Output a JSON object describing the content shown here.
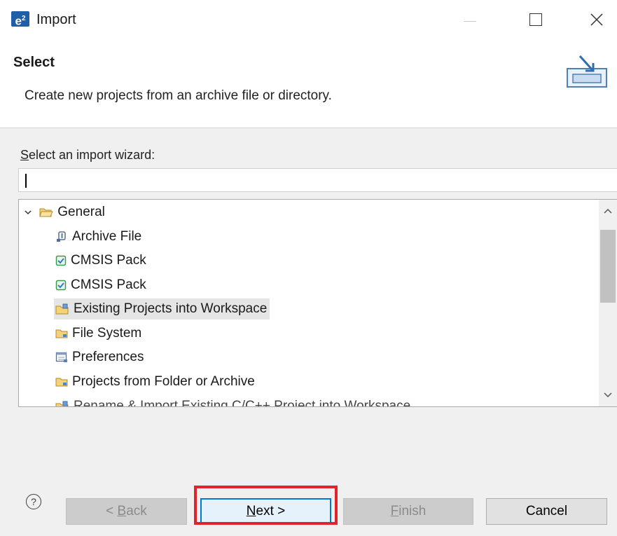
{
  "window": {
    "app_badge": "e",
    "app_badge_sup": "2",
    "title": "Import"
  },
  "header": {
    "title": "Select",
    "description": "Create new projects from an archive file or directory."
  },
  "wizard": {
    "label_first": "S",
    "label_rest": "elect an import wizard:",
    "filter_value": ""
  },
  "tree": {
    "items": [
      {
        "label": "General",
        "icon": "folder-open-icon",
        "expanded": true
      },
      {
        "label": "Archive File",
        "icon": "archive-icon"
      },
      {
        "label": "CMSIS Pack",
        "icon": "checkbox-icon"
      },
      {
        "label": "CMSIS Pack",
        "icon": "checkbox-icon"
      },
      {
        "label": "Existing Projects into Workspace",
        "icon": "project-folder-icon",
        "selected": true
      },
      {
        "label": "File System",
        "icon": "folder-icon"
      },
      {
        "label": "Preferences",
        "icon": "preferences-icon"
      },
      {
        "label": "Projects from Folder or Archive",
        "icon": "folder-icon"
      },
      {
        "label": "Rename & Import Existing C/C++ Project into Workspace",
        "icon": "project-folder-icon"
      }
    ]
  },
  "buttons": {
    "help": "?",
    "back_prefix": "< ",
    "back_mnemonic": "B",
    "back_rest": "ack",
    "next_mnemonic": "N",
    "next_rest": "ext >",
    "finish_mnemonic": "F",
    "finish_rest": "inish",
    "cancel": "Cancel"
  },
  "colors": {
    "accent": "#0078d7",
    "highlight_box": "#e0242b",
    "selection": "#e5e5e5"
  }
}
